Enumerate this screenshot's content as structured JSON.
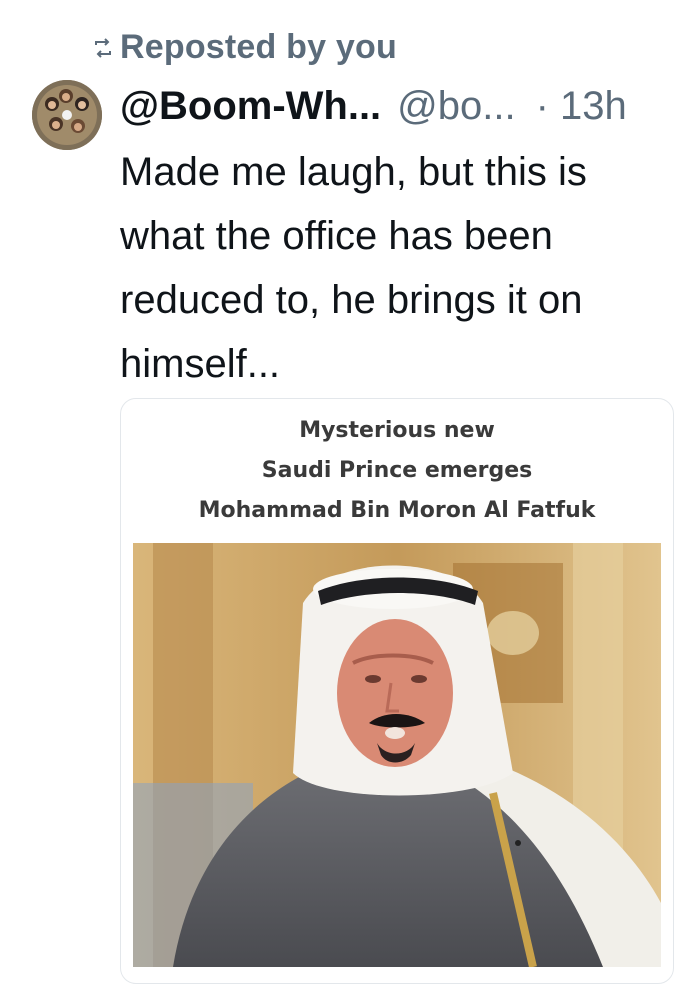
{
  "repost": {
    "icon": "repost-icon",
    "label": "Reposted by you"
  },
  "post": {
    "avatar_icon": "group-photo-avatar",
    "display_name": "@Boom-Wh...",
    "handle": "@bo...",
    "time": "· 13h",
    "text": "Made me laugh, but this is what the office has been reduced to, he brings it on himself..."
  },
  "media": {
    "caption_lines": [
      "Mysterious new",
      "Saudi Prince emerges",
      "Mohammad Bin Moron Al Fatfuk"
    ],
    "photo_icon": "saudi-prince-meme-photo"
  },
  "colors": {
    "text_primary": "#0f1419",
    "text_secondary": "#5b6b7a",
    "card_border": "#e3e7eb"
  }
}
